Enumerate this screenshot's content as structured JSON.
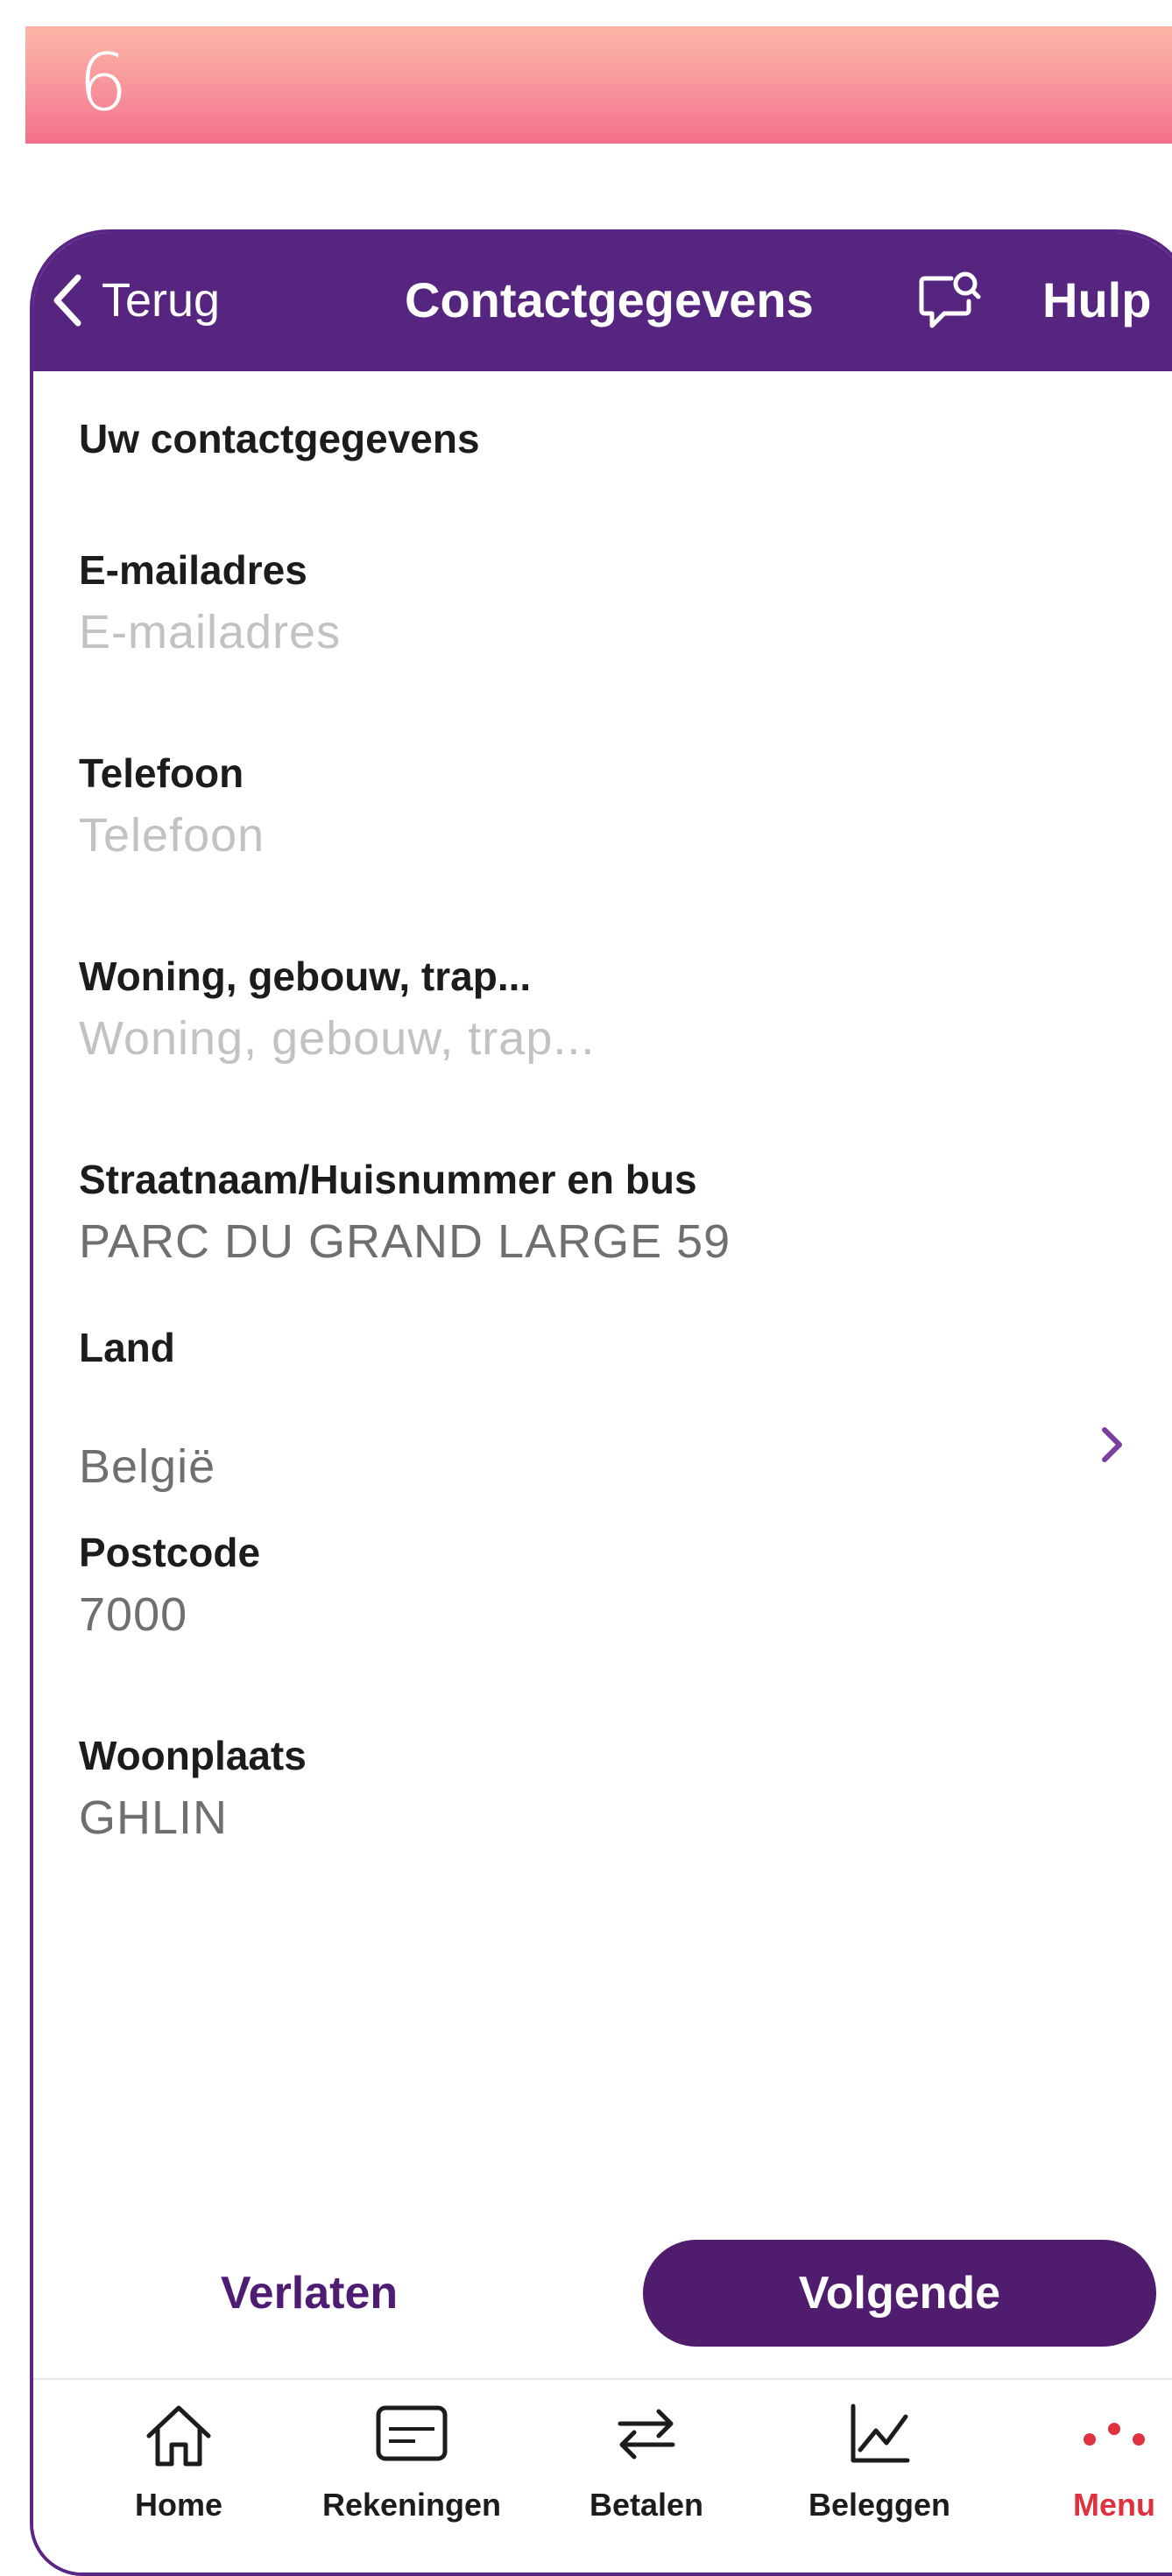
{
  "step": {
    "number": "6"
  },
  "colors": {
    "brand_purple": "#55257f",
    "button_purple": "#4f1c6e",
    "active_tab_red": "#e0323e",
    "banner_gradient_top": "#fdb7a6",
    "banner_gradient_bottom": "#f46f8c"
  },
  "navbar": {
    "back_label": "Terug",
    "back_icon": "chevron-left-icon",
    "title": "Contactgegevens",
    "chat_icon": "chat-search-icon",
    "help_label": "Hulp"
  },
  "form": {
    "section_title": "Uw contactgegevens",
    "email": {
      "label": "E-mailadres",
      "value": "",
      "placeholder": "E-mailadres"
    },
    "phone": {
      "label": "Telefoon",
      "value": "",
      "placeholder": "Telefoon"
    },
    "building": {
      "label": "Woning, gebouw, trap...",
      "value": "",
      "placeholder": "Woning, gebouw, trap..."
    },
    "street": {
      "label": "Straatnaam/Huisnummer en bus",
      "value": "PARC DU GRAND LARGE 59",
      "placeholder": ""
    },
    "country": {
      "label": "Land",
      "value": "België",
      "icon": "chevron-right-icon"
    },
    "postcode": {
      "label": "Postcode",
      "value": "7000",
      "placeholder": ""
    },
    "city": {
      "label": "Woonplaats",
      "value": "GHLIN",
      "placeholder": ""
    }
  },
  "actions": {
    "leave_label": "Verlaten",
    "next_label": "Volgende"
  },
  "tabbar": {
    "items": [
      {
        "label": "Home",
        "icon": "home-icon",
        "active": false
      },
      {
        "label": "Rekeningen",
        "icon": "card-icon",
        "active": false
      },
      {
        "label": "Betalen",
        "icon": "transfer-arrows-icon",
        "active": false
      },
      {
        "label": "Beleggen",
        "icon": "line-chart-icon",
        "active": false
      },
      {
        "label": "Menu",
        "icon": "more-dots-icon",
        "active": true
      }
    ]
  }
}
